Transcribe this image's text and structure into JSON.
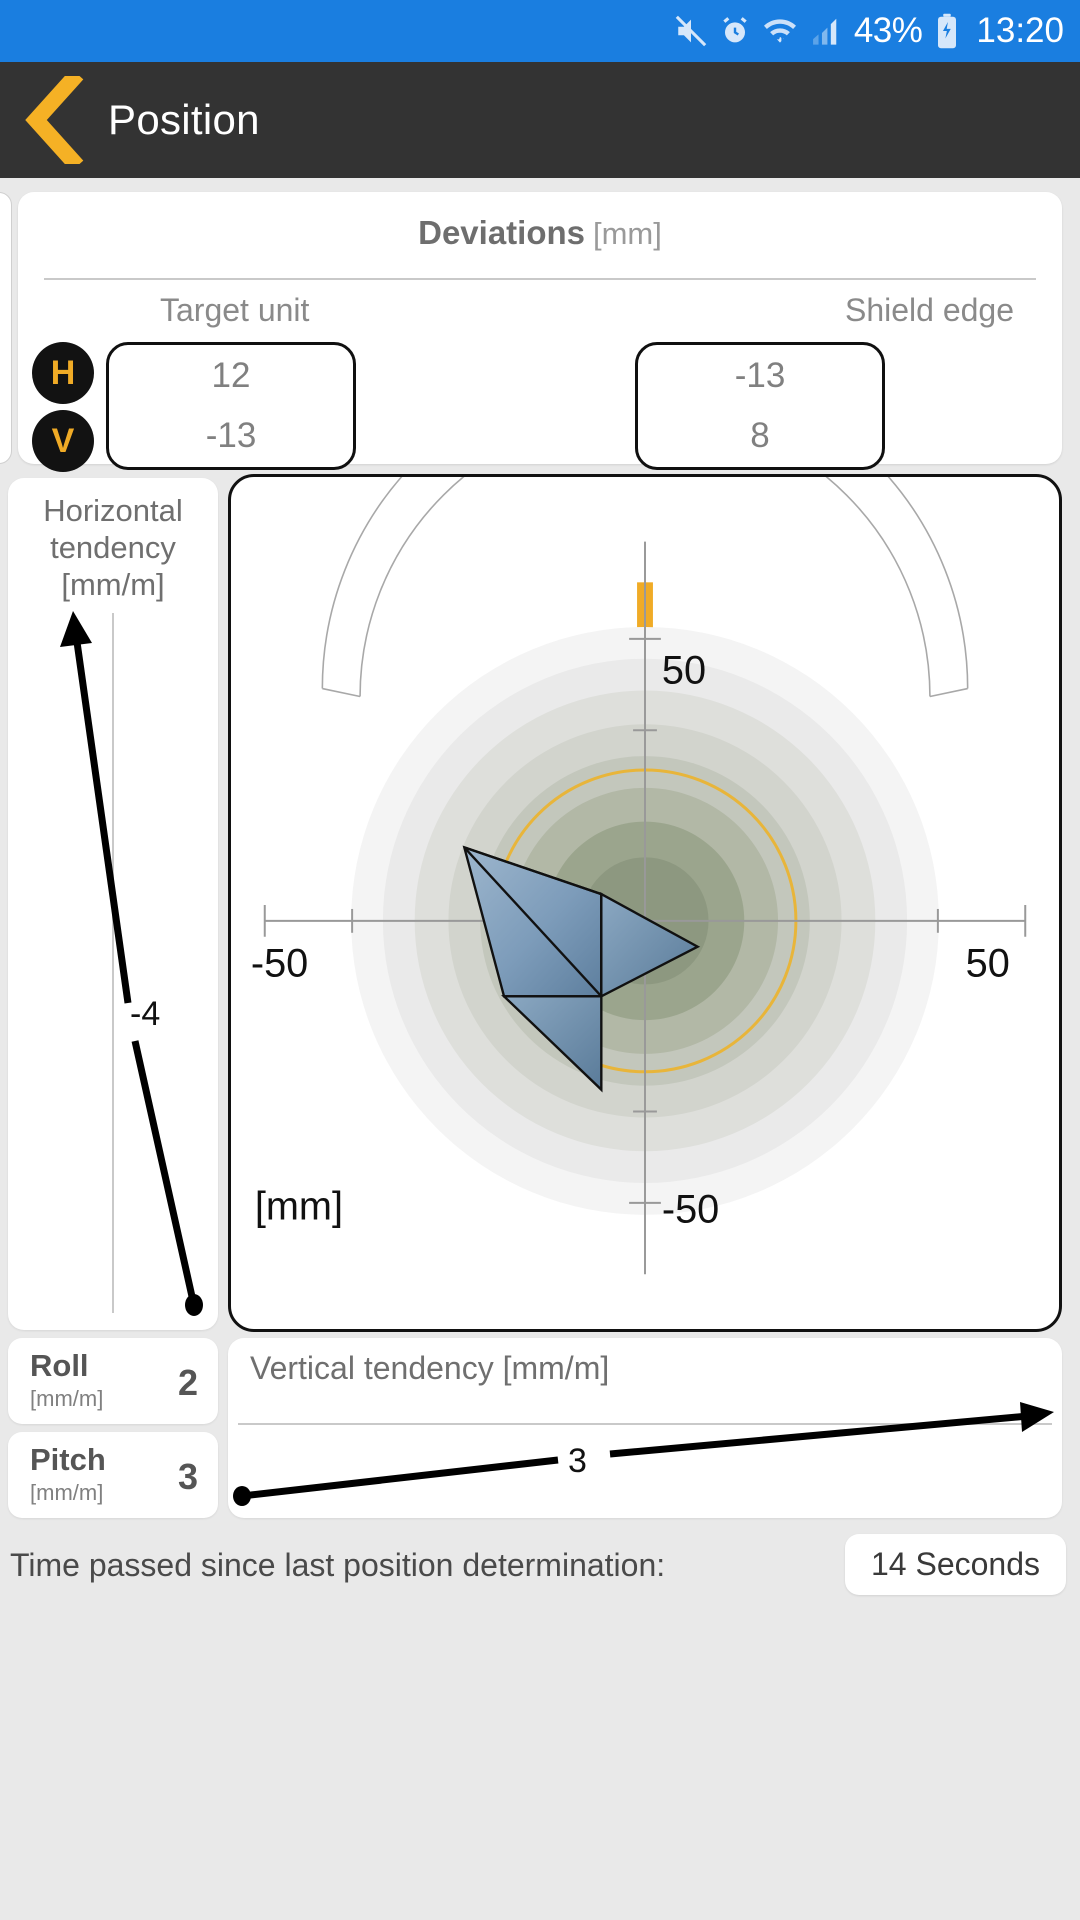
{
  "statusbar": {
    "battery_percent": "43%",
    "time": "13:20",
    "icons": [
      "mute-icon",
      "alarm-icon",
      "wifi-icon",
      "signal-icon",
      "battery-charging-icon"
    ]
  },
  "header": {
    "title": "Position",
    "back_icon": "back-chevron-icon"
  },
  "deviations": {
    "title": "Deviations",
    "unit": "[mm]",
    "columns": [
      "Target unit",
      "Shield edge"
    ],
    "axes": [
      "H",
      "V"
    ],
    "target_unit": {
      "h": "12",
      "v": "-13"
    },
    "shield_edge": {
      "h": "-13",
      "v": "8"
    }
  },
  "horizontal_tendency": {
    "label": "Horizontal tendency [mm/m]",
    "value": "-4"
  },
  "vertical_tendency": {
    "label": "Vertical tendency [mm/m]",
    "value": "3"
  },
  "roll": {
    "name": "Roll",
    "unit": "[mm/m]",
    "value": "2"
  },
  "pitch": {
    "name": "Pitch",
    "unit": "[mm/m]",
    "value": "3"
  },
  "radar": {
    "unit_label": "[mm]",
    "tick_top": "50",
    "tick_bottom": "-50",
    "tick_left": "-50",
    "tick_right": "50",
    "accent_color": "#f0ab26"
  },
  "footer": {
    "text": "Time passed since last position determination:",
    "elapsed": "14 Seconds"
  },
  "chart_data": {
    "type": "scatter",
    "title": "Position deviation target",
    "xlabel": "[mm]",
    "ylabel": "[mm]",
    "xlim": [
      -65,
      65
    ],
    "ylim": [
      -65,
      65
    ],
    "xticks": [
      -50,
      0,
      50
    ],
    "yticks": [
      -50,
      0,
      50
    ],
    "grid": false,
    "legend": "none",
    "tolerance_rings_mm": [
      60,
      50,
      42,
      34,
      26,
      18,
      10
    ],
    "tolerance_ring_highlight_mm": 30,
    "gauge": {
      "min": -1,
      "max": 1,
      "value": 0,
      "marker_color": "#f0ab26"
    },
    "annotations": [
      {
        "text": "50",
        "x": 0,
        "y": 50
      },
      {
        "text": "-50",
        "x": 0,
        "y": -50
      },
      {
        "text": "-50",
        "x": -50,
        "y": 0
      },
      {
        "text": "50",
        "x": 50,
        "y": 0
      }
    ],
    "series": [
      {
        "name": "Horizontal tendency",
        "type": "line",
        "values": [
          -4
        ],
        "unit": "mm/m"
      },
      {
        "name": "Vertical tendency",
        "type": "line",
        "values": [
          3
        ],
        "unit": "mm/m"
      }
    ]
  }
}
